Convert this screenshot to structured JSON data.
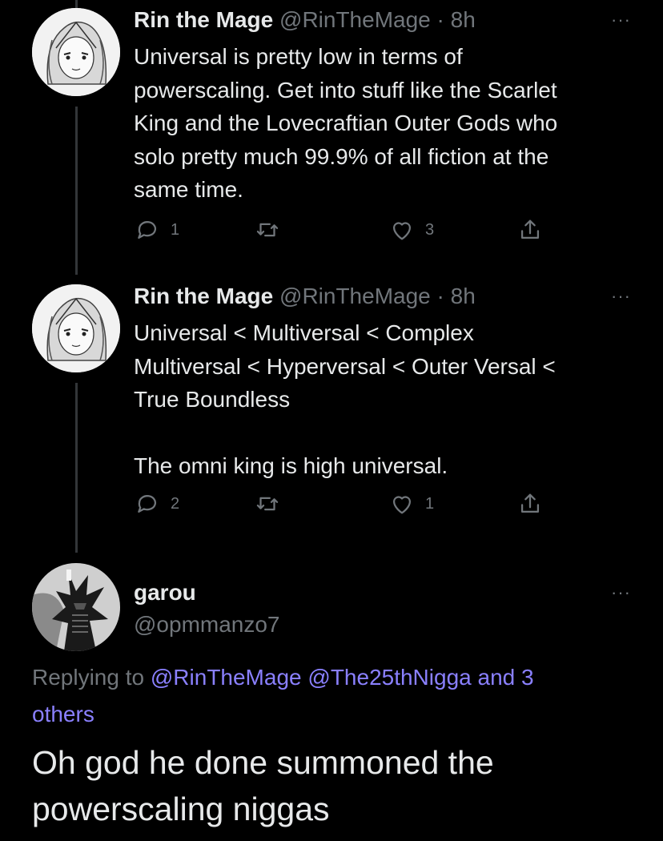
{
  "tweets": [
    {
      "author_name": "Rin the Mage",
      "handle_time": "@RinTheMage · 8h",
      "text": "Universal is pretty low in terms of\npowerscaling. Get into stuff like the Scarlet\nKing and the Lovecraftian Outer Gods who\nsolo pretty much 99.9% of all fiction at the\nsame time.",
      "reply_count": "1",
      "like_count": "3",
      "more": "···"
    },
    {
      "author_name": "Rin the Mage",
      "handle_time": "@RinTheMage · 8h",
      "text": "Universal < Multiversal < Complex\nMultiversal < Hyperversal < Outer Versal <\nTrue Boundless\n\nThe omni king is high universal.",
      "reply_count": "2",
      "like_count": "1",
      "more": "···"
    }
  ],
  "main_tweet": {
    "author_name": "garou",
    "handle": "@opmmanzo7",
    "more": "···",
    "replying_prefix": "Replying to ",
    "mention_1": "@RinTheMage",
    "mention_2": "@The25thNigga",
    "and_others": "and 3",
    "others": "others",
    "text": "Oh god he done summoned the\npowerscaling niggas"
  },
  "colors": {
    "background": "#000000",
    "text": "#e7e9ea",
    "muted": "#71767b",
    "link": "#8a80ff",
    "thread_line": "#333639"
  },
  "icons": [
    "reply-icon",
    "retweet-icon",
    "like-icon",
    "share-icon",
    "more-icon"
  ]
}
